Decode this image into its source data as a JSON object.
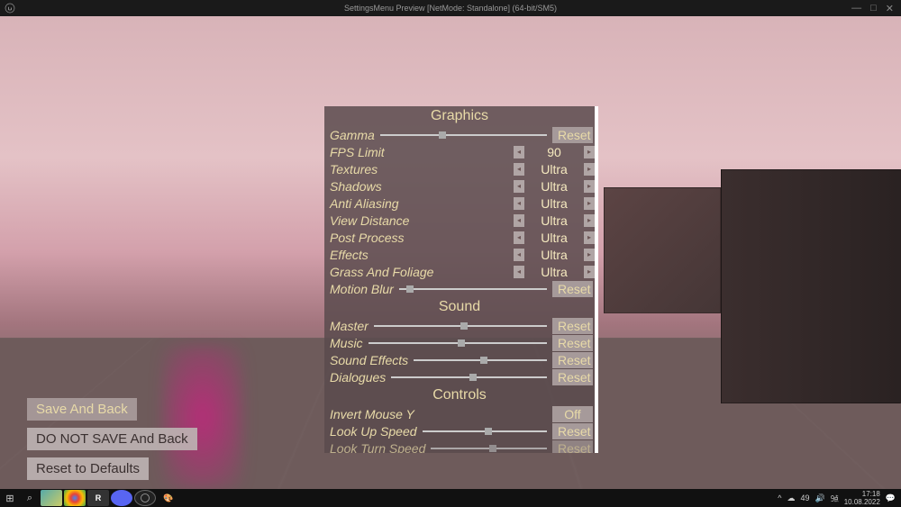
{
  "window": {
    "title": "SettingsMenu Preview [NetMode: Standalone]  (64-bit/SM5)"
  },
  "settings": {
    "graphics": {
      "header": "Graphics",
      "gamma": {
        "label": "Gamma",
        "reset": "Reset",
        "sliderPos": 35
      },
      "fps": {
        "label": "FPS Limit",
        "value": "90"
      },
      "textures": {
        "label": "Textures",
        "value": "Ultra"
      },
      "shadows": {
        "label": "Shadows",
        "value": "Ultra"
      },
      "aa": {
        "label": "Anti Aliasing",
        "value": "Ultra"
      },
      "viewdist": {
        "label": "View Distance",
        "value": "Ultra"
      },
      "postproc": {
        "label": "Post Process",
        "value": "Ultra"
      },
      "effects": {
        "label": "Effects",
        "value": "Ultra"
      },
      "foliage": {
        "label": "Grass And Foliage",
        "value": "Ultra"
      },
      "motionblur": {
        "label": "Motion Blur",
        "reset": "Reset",
        "sliderPos": 5
      }
    },
    "sound": {
      "header": "Sound",
      "master": {
        "label": "Master",
        "reset": "Reset",
        "sliderPos": 50
      },
      "music": {
        "label": "Music",
        "reset": "Reset",
        "sliderPos": 50
      },
      "sfx": {
        "label": "Sound Effects",
        "reset": "Reset",
        "sliderPos": 50
      },
      "dialogues": {
        "label": "Dialogues",
        "reset": "Reset",
        "sliderPos": 50
      }
    },
    "controls": {
      "header": "Controls",
      "invert": {
        "label": "Invert Mouse Y",
        "value": "Off"
      },
      "lookup": {
        "label": "Look Up Speed",
        "reset": "Reset",
        "sliderPos": 50
      },
      "lookturn": {
        "label": "Look Turn Speed",
        "reset": "Reset",
        "sliderPos": 50
      }
    }
  },
  "sideButtons": {
    "save": "Save And Back",
    "nosave": "DO NOT SAVE And Back",
    "reset": "Reset to Defaults"
  },
  "taskbar": {
    "time": "17:18",
    "date": "10.08.2022",
    "temp": "49"
  }
}
